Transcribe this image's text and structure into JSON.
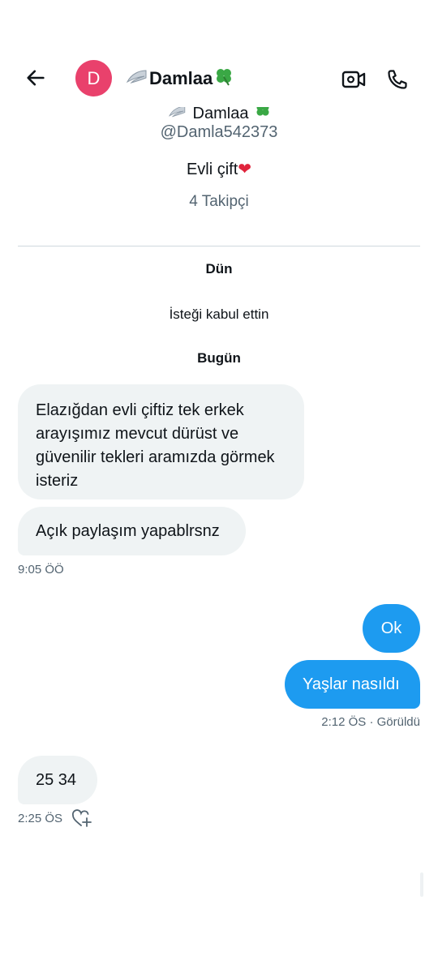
{
  "header": {
    "avatar_letter": "D",
    "display_name": "Damlaa",
    "icons": [
      "back-arrow-icon",
      "video-camera-icon",
      "phone-icon"
    ]
  },
  "profile": {
    "display_name": "Damlaa",
    "handle": "@Damla542373",
    "bio": "Evli çift",
    "followers": "4 Takipçi"
  },
  "conversation": {
    "day_yesterday": "Dün",
    "request_accepted": "İsteği kabul ettin",
    "day_today": "Bugün",
    "msg1": "Elazığdan evli çiftiz tek erkek arayışımız mevcut dürüst ve güvenilir tekleri aramızda görmek isteriz",
    "msg2": "Açık paylaşım yapablrsnz",
    "time1": "9:05 ÖÖ",
    "reply1": "Ok",
    "reply2": "Yaşlar nasıldı",
    "time2": "2:12 ÖS · Görüldü",
    "msg3": "25 34",
    "time3": "2:25 ÖS"
  },
  "colors": {
    "accent": "#1d9bf0",
    "avatar": "#e9416c",
    "incoming_bubble": "#eff3f4",
    "secondary_text": "#536471"
  }
}
